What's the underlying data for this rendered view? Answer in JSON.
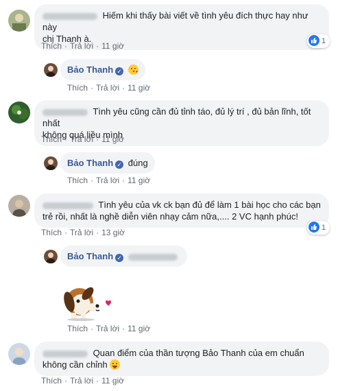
{
  "comments": [
    {
      "text_line1": "Hiếm khi thấy bài viết về tình yêu đích thực hay như này",
      "text_line2": "chị Thanh à.",
      "like_label": "Thích",
      "reply_label": "Trả lời",
      "time": "11 giờ",
      "reaction_count": "1"
    },
    {
      "author": "Bảo Thanh",
      "like_label": "Thích",
      "reply_label": "Trả lời",
      "time": "11 giờ"
    },
    {
      "text_line1": "Tình yêu cũng cần đủ tỉnh táo, đủ lý trí , đủ bản lĩnh, tốt nhất",
      "text_line2": "không quá liều mình",
      "like_label": "Thích",
      "reply_label": "Trả lời",
      "time": "11 giờ"
    },
    {
      "author": "Bảo Thanh",
      "text": "đúng",
      "like_label": "Thích",
      "reply_label": "Trả lời",
      "time": "11 giờ"
    },
    {
      "text_line1": "Tình yêu của vk ck bạn đủ để làm 1 bài học cho các bạn",
      "text_line2": "trẻ rồi, nhất là nghề diễn viên nhạy cảm nữa,.... 2 VC hạnh phúc!",
      "like_label": "Thích",
      "reply_label": "Trả lời",
      "time": "13 giờ",
      "reaction_count": "1"
    },
    {
      "author": "Bảo Thanh",
      "like_label": "Thích",
      "reply_label": "Trả lời",
      "time": "11 giờ"
    },
    {
      "text_line1": "Quan điểm của thần tượng Bảo Thanh của em chuẩn",
      "text_line2": "không cần chỉnh",
      "like_label": "Thích",
      "reply_label": "Trả lời",
      "time": "11 giờ"
    }
  ],
  "colors": {
    "bubble": "#f2f3f5",
    "name": "#385898",
    "meta": "#606770",
    "like_blue": "#2078f4"
  }
}
